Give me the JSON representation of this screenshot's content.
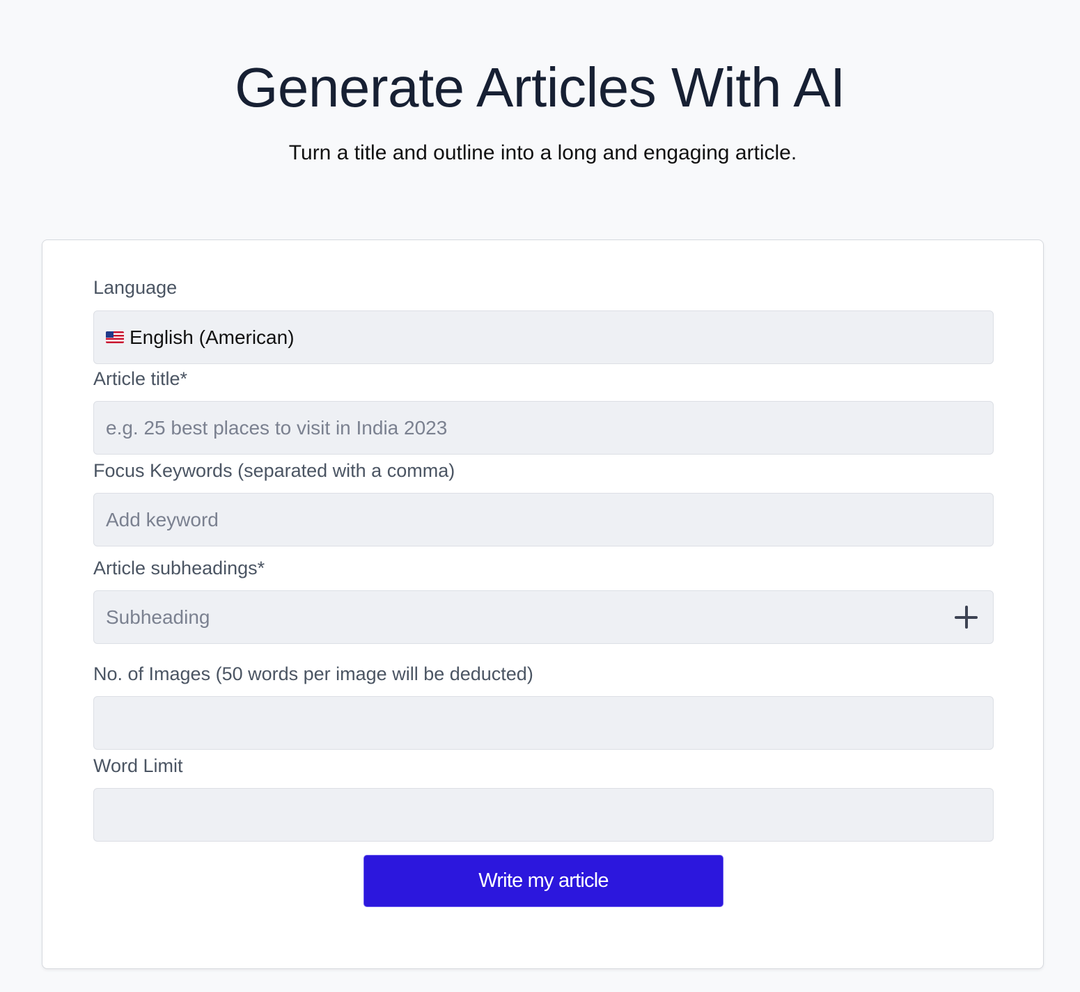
{
  "header": {
    "title": "Generate Articles With AI",
    "subtitle": "Turn a title and outline into a long and engaging article."
  },
  "form": {
    "language": {
      "label": "Language",
      "flag_icon": "us-flag-icon",
      "value": "English (American)"
    },
    "article_title": {
      "label": "Article title*",
      "placeholder": "e.g. 25 best places to visit in India 2023",
      "value": ""
    },
    "focus_keywords": {
      "label": "Focus Keywords (separated with a comma)",
      "placeholder": "Add keyword",
      "value": ""
    },
    "subheadings": {
      "label": "Article subheadings*",
      "placeholder": "Subheading",
      "value": "",
      "add_icon": "plus-icon"
    },
    "num_images": {
      "label": "No. of Images (50 words per image will be deducted)",
      "value": ""
    },
    "word_limit": {
      "label": "Word Limit",
      "value": ""
    },
    "submit_label": "Write my article"
  },
  "colors": {
    "page_background": "#f8f9fb",
    "field_background": "#eef0f4",
    "button_background": "#2c17dd",
    "button_text": "#ffffff"
  }
}
